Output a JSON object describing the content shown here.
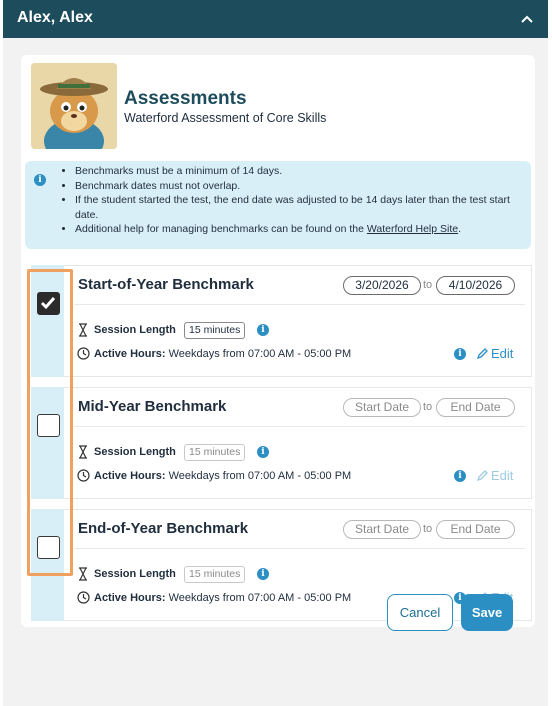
{
  "header": {
    "title": "Alex, Alex",
    "chevron_icon": "chevron-up-icon"
  },
  "assessment": {
    "title": "Assessments",
    "subtitle": "Waterford Assessment of Core Skills",
    "avatar_icon": "mascot-avatar"
  },
  "info": {
    "icon": "info-icon",
    "items": [
      "Benchmarks must be a minimum of 14 days.",
      "Benchmark dates must not overlap.",
      "If the student started the test, the end date was adjusted to be 14 days later than the test start date."
    ],
    "help_prefix": "Additional help for managing benchmarks can be found on the ",
    "help_link": "Waterford Help Site",
    "help_suffix": "."
  },
  "benchmarks": [
    {
      "title": "Start-of-Year Benchmark",
      "checked": true,
      "start_date": "3/20/2026",
      "to_label": "to",
      "end_date": "4/10/2026",
      "session_label": "Session Length",
      "session_value": "15 minutes",
      "hours_label": "Active Hours:",
      "hours_value": "Weekdays from 07:00 AM - 05:00 PM",
      "edit_label": "Edit"
    },
    {
      "title": "Mid-Year Benchmark",
      "checked": false,
      "start_date": "Start Date",
      "to_label": "to",
      "end_date": "End Date",
      "session_label": "Session Length",
      "session_value": "15 minutes",
      "hours_label": "Active Hours:",
      "hours_value": "Weekdays from 07:00 AM - 05:00 PM",
      "edit_label": "Edit"
    },
    {
      "title": "End-of-Year Benchmark",
      "checked": false,
      "start_date": "Start Date",
      "to_label": "to",
      "end_date": "End Date",
      "session_label": "Session Length",
      "session_value": "15 minutes",
      "hours_label": "Active Hours:",
      "hours_value": "Weekdays from 07:00 AM - 05:00 PM",
      "edit_label": "Edit"
    }
  ],
  "actions": {
    "cancel_label": "Cancel",
    "save_label": "Save"
  },
  "colors": {
    "header_bg": "#1d4d5c",
    "accent": "#2b8fc4",
    "info_bg": "#d9eff7",
    "highlight_frame": "#f0a160"
  }
}
